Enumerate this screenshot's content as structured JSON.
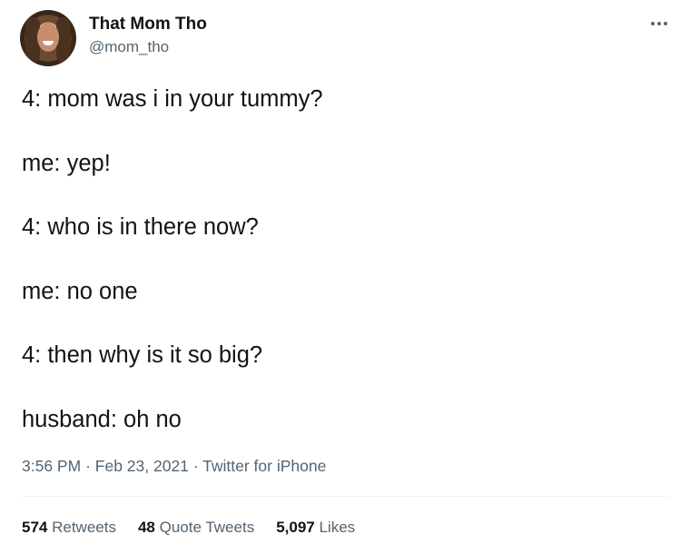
{
  "author": {
    "name": "That Mom Tho",
    "handle": "@mom_tho"
  },
  "more_icon": "more-horizontal-icon",
  "tweet_lines": [
    "4: mom was i in your tummy?",
    "me: yep!",
    "4: who is in there now?",
    "me: no one",
    "4: then why is it so big?",
    "husband: oh no"
  ],
  "meta": {
    "time": "3:56 PM",
    "separator": "·",
    "date": "Feb 23, 2021",
    "source": "Twitter for iPhone"
  },
  "stats": {
    "retweets_count": "574",
    "retweets_label": "Retweets",
    "quotes_count": "48",
    "quotes_label": "Quote Tweets",
    "likes_count": "5,097",
    "likes_label": "Likes"
  },
  "colors": {
    "text_primary": "#0f1419",
    "text_secondary": "#536471",
    "divider": "#eff3f4"
  }
}
